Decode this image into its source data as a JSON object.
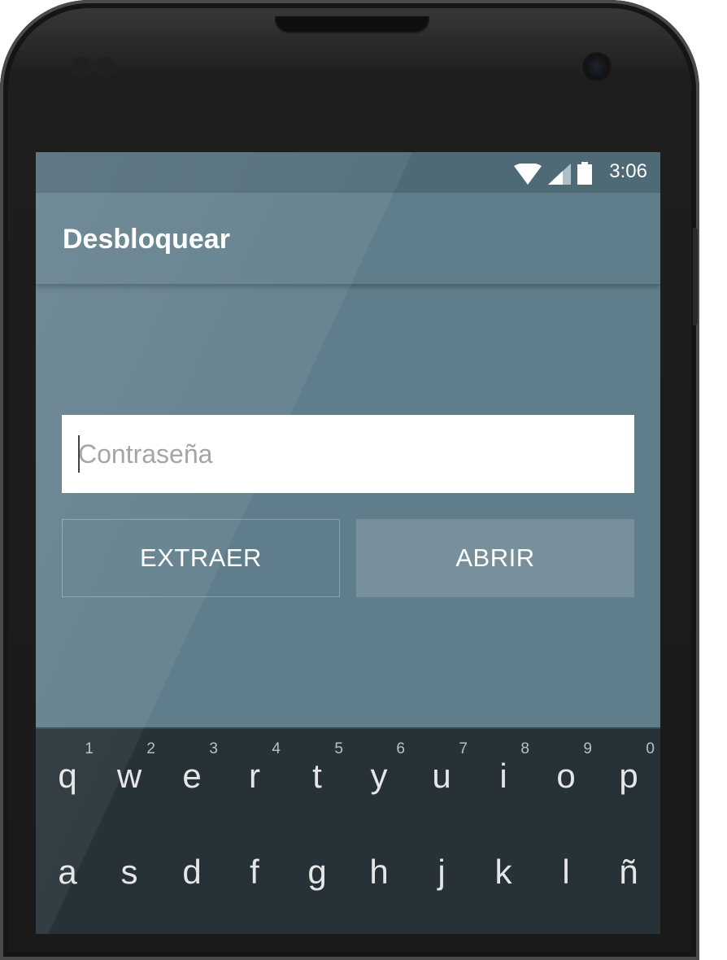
{
  "status_bar": {
    "time": "3:06",
    "icons": [
      "wifi-icon",
      "signal-icon",
      "battery-icon"
    ]
  },
  "app_bar": {
    "title": "Desbloquear"
  },
  "password_field": {
    "placeholder": "Contraseña",
    "value": ""
  },
  "buttons": {
    "extract_label": "EXTRAER",
    "open_label": "ABRIR"
  },
  "keyboard": {
    "row1": [
      {
        "key": "q",
        "hint": "1"
      },
      {
        "key": "w",
        "hint": "2"
      },
      {
        "key": "e",
        "hint": "3"
      },
      {
        "key": "r",
        "hint": "4"
      },
      {
        "key": "t",
        "hint": "5"
      },
      {
        "key": "y",
        "hint": "6"
      },
      {
        "key": "u",
        "hint": "7"
      },
      {
        "key": "i",
        "hint": "8"
      },
      {
        "key": "o",
        "hint": "9"
      },
      {
        "key": "p",
        "hint": "0"
      }
    ],
    "row2": [
      {
        "key": "a"
      },
      {
        "key": "s"
      },
      {
        "key": "d"
      },
      {
        "key": "f"
      },
      {
        "key": "g"
      },
      {
        "key": "h"
      },
      {
        "key": "j"
      },
      {
        "key": "k"
      },
      {
        "key": "l"
      },
      {
        "key": "ñ"
      }
    ]
  },
  "colors": {
    "primary": "#607d8b",
    "status_bar": "#4e6a77",
    "accent_button": "#78909c",
    "keyboard_bg": "#263238"
  }
}
